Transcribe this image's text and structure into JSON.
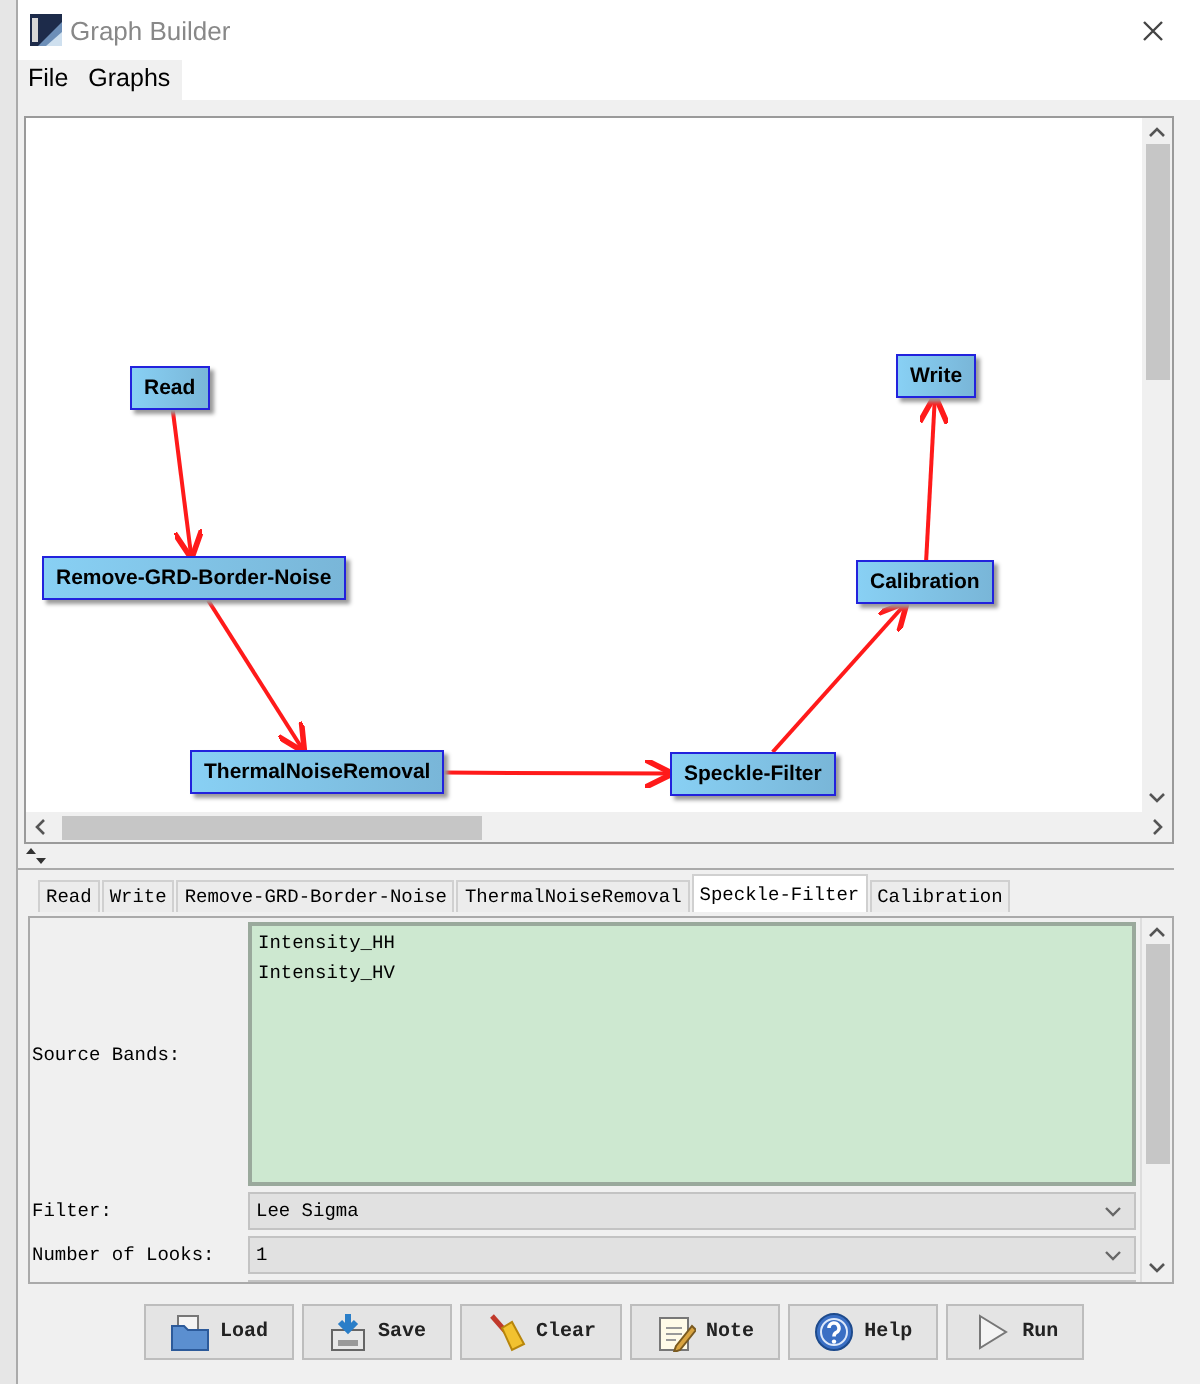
{
  "window": {
    "title": "Graph Builder"
  },
  "menu": [
    {
      "label": "File"
    },
    {
      "label": "Graphs"
    }
  ],
  "graph": {
    "nodes": [
      {
        "label": "Read"
      },
      {
        "label": "Remove-GRD-Border-Noise"
      },
      {
        "label": "ThermalNoiseRemoval"
      },
      {
        "label": "Speckle-Filter"
      },
      {
        "label": "Calibration"
      },
      {
        "label": "Write"
      }
    ]
  },
  "tabs": [
    {
      "label": "Read",
      "selected": false
    },
    {
      "label": "Write",
      "selected": false
    },
    {
      "label": "Remove-GRD-Border-Noise",
      "selected": false
    },
    {
      "label": "ThermalNoiseRemoval",
      "selected": false
    },
    {
      "label": "Speckle-Filter",
      "selected": true
    },
    {
      "label": "Calibration",
      "selected": false
    }
  ],
  "parameters": [
    {
      "kind": "list",
      "label": "Source Bands:",
      "items": [
        "Intensity_HH",
        "Intensity_HV"
      ]
    },
    {
      "kind": "dropdown",
      "label": "Filter:",
      "value": "Lee Sigma"
    },
    {
      "kind": "dropdown",
      "label": "Number of Looks:",
      "value": "1"
    }
  ],
  "buttons": [
    {
      "kind": "load",
      "label": "Load"
    },
    {
      "kind": "save",
      "label": "Save"
    },
    {
      "kind": "clear",
      "label": "Clear"
    },
    {
      "kind": "note",
      "label": "Note"
    },
    {
      "kind": "help",
      "label": "Help"
    },
    {
      "kind": "run",
      "label": "Run"
    }
  ]
}
